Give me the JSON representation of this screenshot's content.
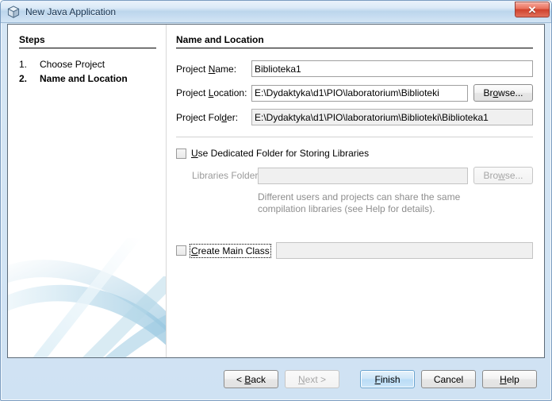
{
  "window": {
    "title": "New Java Application",
    "icon": "java-cube-icon",
    "close_label": "✕",
    "accent": "#cfe2f3",
    "default_button_accent": "#b9dcf6"
  },
  "steps_panel": {
    "heading": "Steps",
    "items": [
      {
        "number": "1.",
        "label": "Choose Project",
        "active": false
      },
      {
        "number": "2.",
        "label": "Name and Location",
        "active": true
      }
    ]
  },
  "main_panel": {
    "heading": "Name and Location",
    "fields": {
      "project_name": {
        "label_pre": "Project ",
        "label_mnemonic": "N",
        "label_post": "ame:",
        "value": "Biblioteka1",
        "placeholder": ""
      },
      "project_location": {
        "label_pre": "Project ",
        "label_mnemonic": "L",
        "label_post": "ocation:",
        "value": "E:\\Dydaktyka\\d1\\PIO\\laboratorium\\Biblioteki",
        "placeholder": "",
        "browse_pre": "Br",
        "browse_mnemonic": "o",
        "browse_post": "wse..."
      },
      "project_folder": {
        "label_pre": "Project Fol",
        "label_mnemonic": "d",
        "label_post": "er:",
        "value": "E:\\Dydaktyka\\d1\\PIO\\laboratorium\\Biblioteki\\Biblioteka1"
      },
      "libraries_folder": {
        "label": "Libraries Folder:",
        "value": "",
        "placeholder": "",
        "browse_pre": "Bro",
        "browse_mnemonic": "w",
        "browse_post": "se...",
        "disabled": true
      },
      "main_class": {
        "value": "",
        "placeholder": "",
        "disabled": true
      }
    },
    "checkboxes": {
      "dedicated_folder": {
        "mnemonic": "U",
        "label_post": "se Dedicated Folder for Storing Libraries",
        "checked": false
      },
      "create_main_class": {
        "mnemonic": "C",
        "label_post": "reate Main Class",
        "checked": false,
        "focused": true
      }
    },
    "hint_line1": "Different users and projects can share the same",
    "hint_line2": "compilation libraries (see Help for details)."
  },
  "buttons": {
    "back": {
      "pre": "< ",
      "mnemonic": "B",
      "post": "ack",
      "disabled": false
    },
    "next": {
      "pre": "",
      "mnemonic": "N",
      "post": "ext >",
      "disabled": true
    },
    "finish": {
      "pre": "",
      "mnemonic": "F",
      "post": "inish",
      "disabled": false,
      "default": true
    },
    "cancel": {
      "pre": "Cancel",
      "mnemonic": "",
      "post": "",
      "disabled": false
    },
    "help": {
      "pre": "",
      "mnemonic": "H",
      "post": "elp",
      "disabled": false
    }
  }
}
